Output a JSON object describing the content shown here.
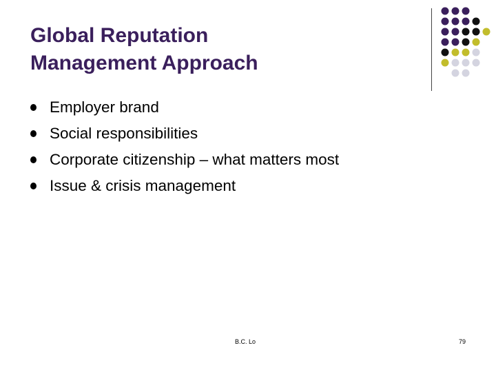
{
  "slide": {
    "title_line1": "Global Reputation",
    "title_line2": "Management Approach",
    "bullets": [
      "Employer brand",
      "Social responsibilities",
      "Corporate citizenship – what matters most",
      "Issue & crisis management"
    ],
    "footer_author": "B.C. Lo",
    "page_number": "79"
  },
  "colors": {
    "title": "#3a1f5c",
    "dot_purple": "#3a1f5c",
    "dot_black": "#111111",
    "dot_olive": "#c2bd2c",
    "dot_light": "#d4d4e0"
  }
}
